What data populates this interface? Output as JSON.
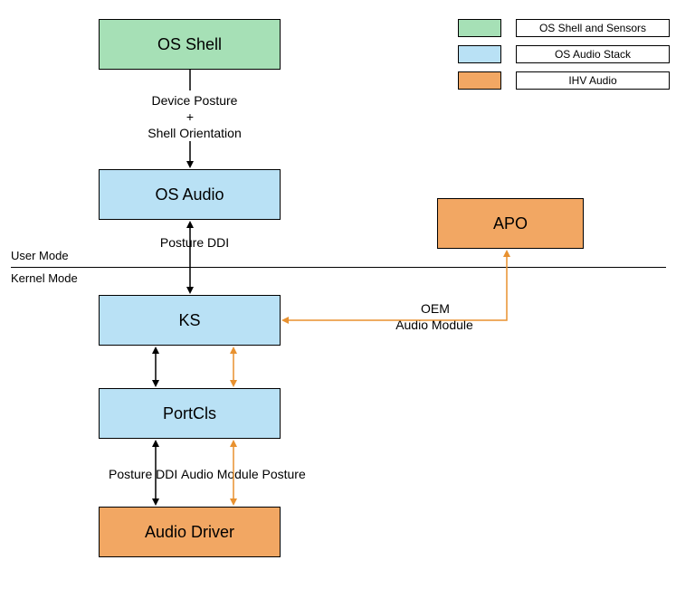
{
  "nodes": {
    "os_shell": "OS Shell",
    "os_audio": "OS Audio",
    "ks": "KS",
    "portcls": "PortCls",
    "audio_driver": "Audio Driver",
    "apo": "APO"
  },
  "labels": {
    "device_posture": "Device Posture",
    "plus": "+",
    "shell_orientation": "Shell Orientation",
    "posture_ddi_top": "Posture DDI",
    "posture_ddi_bottom": "Posture DDI",
    "audio_module_posture": "Audio Module Posture",
    "oem": "OEM",
    "audio_module": "Audio Module",
    "user_mode": "User Mode",
    "kernel_mode": "Kernel Mode"
  },
  "legend": {
    "os_shell_sensors": "OS Shell and Sensors",
    "os_audio_stack": "OS Audio Stack",
    "ihv_audio": "IHV Audio"
  },
  "colors": {
    "green": "#a6e0b6",
    "blue": "#b9e1f5",
    "orange": "#f2a763",
    "arrow_black": "#000000",
    "arrow_orange": "#e8912f"
  }
}
